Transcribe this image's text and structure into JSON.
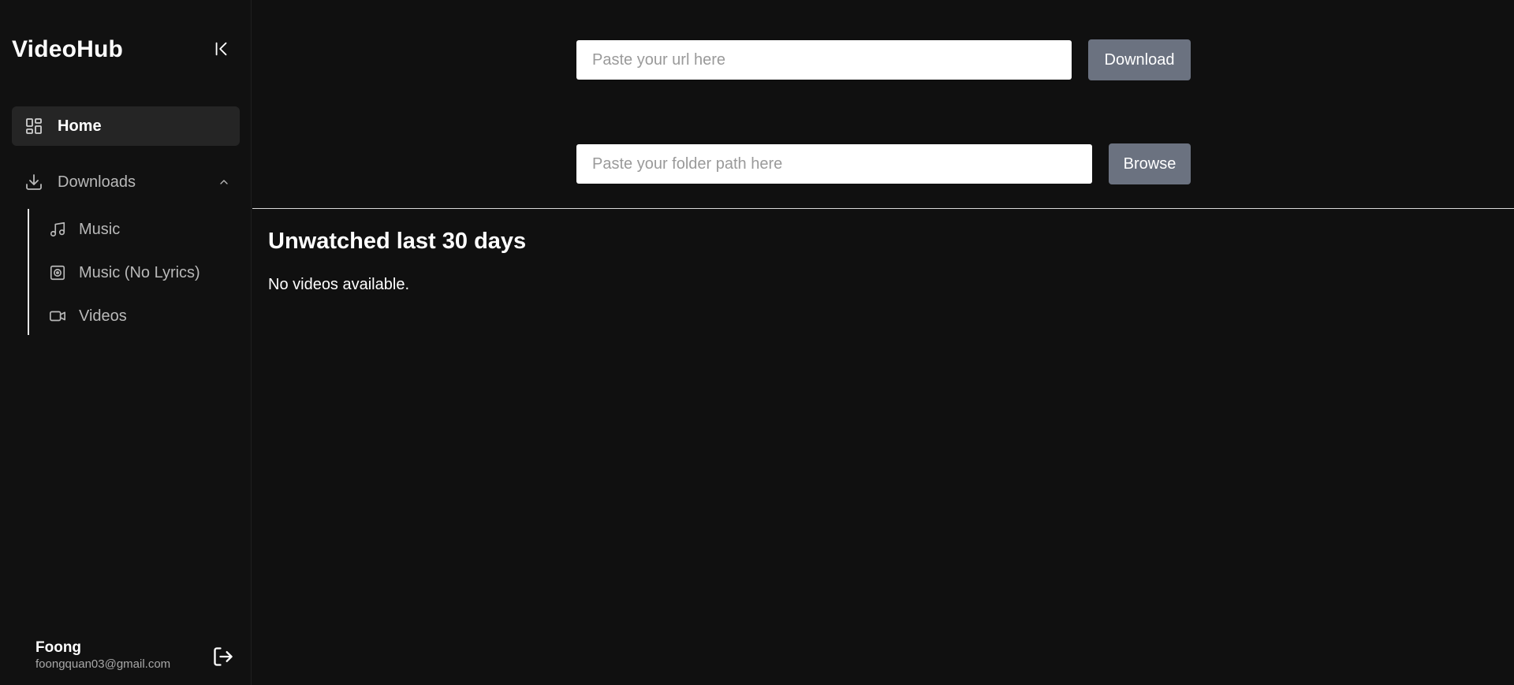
{
  "sidebar": {
    "brand": "VideoHub",
    "items": [
      {
        "label": "Home",
        "icon": "dashboard-icon",
        "active": true
      },
      {
        "label": "Downloads",
        "icon": "download-icon",
        "expanded": true
      }
    ],
    "sub_items": [
      {
        "label": "Music",
        "icon": "music-note-icon"
      },
      {
        "label": "Music (No Lyrics)",
        "icon": "speaker-icon"
      },
      {
        "label": "Videos",
        "icon": "video-camera-icon"
      }
    ],
    "user": {
      "name": "Foong",
      "email": "foongquan03@gmail.com"
    }
  },
  "main": {
    "url_input": {
      "value": "",
      "placeholder": "Paste your url here"
    },
    "download_label": "Download",
    "folder_input": {
      "value": "",
      "placeholder": "Paste your folder path here"
    },
    "browse_label": "Browse",
    "section_title": "Unwatched last 30 days",
    "empty_message": "No videos available."
  },
  "colors": {
    "background": "#101010",
    "active_nav": "#252525",
    "button": "#6b7280",
    "muted_text": "#b9b9b9"
  }
}
